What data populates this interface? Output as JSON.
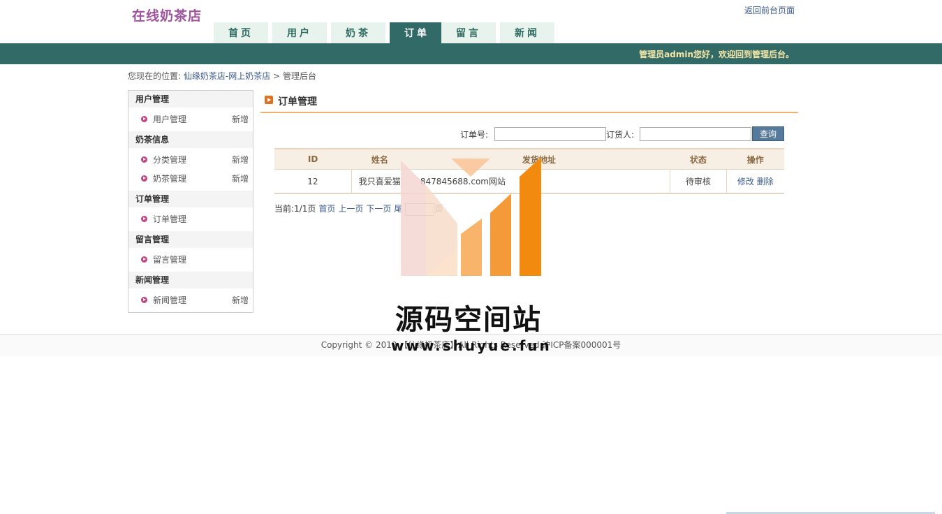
{
  "header": {
    "logo": "在线奶茶店",
    "back_link": "返回前台页面",
    "welcome": "管理员admin您好，欢迎回到管理后台。"
  },
  "nav": {
    "tabs": [
      {
        "label": "首页",
        "active": false
      },
      {
        "label": "用户",
        "active": false
      },
      {
        "label": "奶茶",
        "active": false
      },
      {
        "label": "订单",
        "active": true
      },
      {
        "label": "留言",
        "active": false
      },
      {
        "label": "新闻",
        "active": false
      }
    ]
  },
  "breadcrumb": {
    "prefix": "您现在的位置:",
    "site": "仙缘奶茶店-网上奶茶店",
    "sep": ">",
    "current": "管理后台"
  },
  "sidebar": {
    "groups": [
      {
        "title": "用户管理",
        "items": [
          {
            "label": "用户管理",
            "add": "新增"
          }
        ]
      },
      {
        "title": "奶茶信息",
        "items": [
          {
            "label": "分类管理",
            "add": "新增"
          },
          {
            "label": "奶茶管理",
            "add": "新增"
          }
        ]
      },
      {
        "title": "订单管理",
        "items": [
          {
            "label": "订单管理",
            "add": ""
          }
        ]
      },
      {
        "title": "留言管理",
        "items": [
          {
            "label": "留言管理",
            "add": ""
          }
        ]
      },
      {
        "title": "新闻管理",
        "items": [
          {
            "label": "新闻管理",
            "add": "新增"
          }
        ]
      }
    ]
  },
  "panel": {
    "title": "订单管理"
  },
  "search": {
    "order_no_label": "订单号:",
    "order_no_value": "",
    "buyer_label": "订货人:",
    "buyer_value": "",
    "button": "查询"
  },
  "table": {
    "headers": [
      "ID",
      "姓名",
      "发货地址",
      "状态",
      "操作"
    ],
    "rows": [
      {
        "id": "12",
        "name": "我只喜爱猫",
        "address": "847845688.com网站",
        "status": "待审核",
        "edit": "修改",
        "delete": "删除"
      }
    ]
  },
  "pager": {
    "current": "当前:1/1页",
    "first": "首页",
    "prev": "上一页",
    "next": "下一页",
    "last": "尾",
    "go": "页"
  },
  "footer": {
    "text": "Copyright © 2019 【仙缘奶茶店】All Rights Reserved 沪ICP备案000001号"
  },
  "watermark": {
    "title": "源码空间站",
    "url": "www.shuyue.fun"
  },
  "colors": {
    "header_bar": "#326a68",
    "nav_tab": "#e8f3ee",
    "logo": "#a0529c",
    "accent_orange": "#f0b074"
  }
}
